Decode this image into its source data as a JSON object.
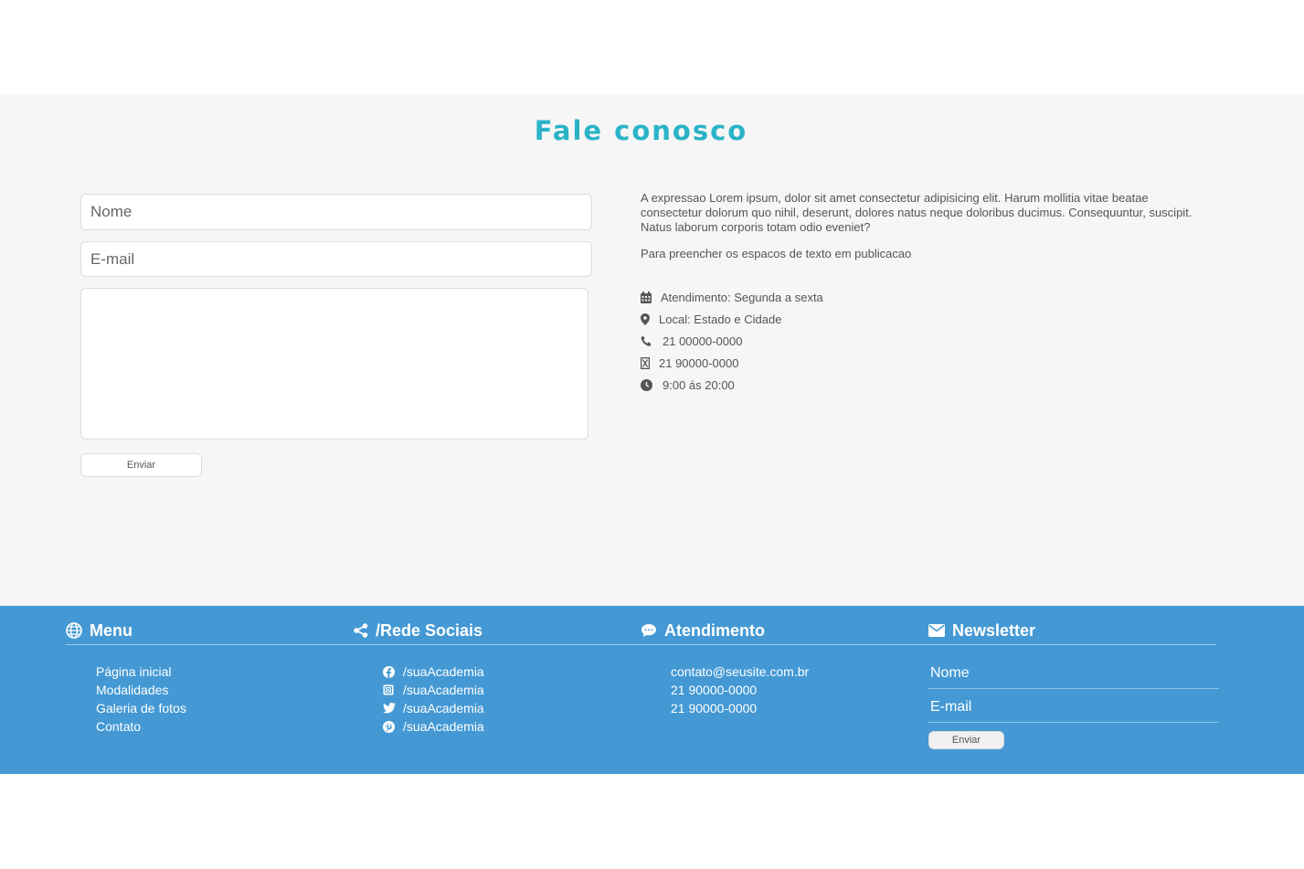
{
  "contact": {
    "title": "Fale conosco",
    "form": {
      "name_placeholder": "Nome",
      "email_placeholder": "E-mail",
      "message_placeholder": "",
      "send_label": "Enviar"
    },
    "description": "A expressao Lorem ipsum, dolor sit amet consectetur adipisicing elit. Harum mollitia vitae beatae consectetur dolorum quo nihil, deserunt, dolores natus neque doloribus ducimus. Consequuntur, suscipit. Natus laborum corporis totam odio eveniet?",
    "subtext": "Para preencher os espacos de texto em publicacao",
    "info": [
      {
        "icon": "calendar-icon",
        "text": "Atendimento: Segunda a sexta"
      },
      {
        "icon": "map-pin-icon",
        "text": "Local: Estado e Cidade"
      },
      {
        "icon": "phone-icon",
        "text": "21 00000-0000"
      },
      {
        "icon": "mobile-icon",
        "text": "21 90000-0000"
      },
      {
        "icon": "clock-icon",
        "text": "9:00 ás 20:00"
      }
    ]
  },
  "footer": {
    "menu": {
      "heading": "Menu",
      "icon": "globe-icon",
      "items": [
        "Página inicial",
        "Modalidades",
        "Galeria de fotos",
        "Contato"
      ]
    },
    "social": {
      "heading": "/Rede Sociais",
      "icon": "share-icon",
      "items": [
        {
          "icon": "facebook-icon",
          "text": "/suaAcademia"
        },
        {
          "icon": "instagram-icon",
          "text": "/suaAcademia"
        },
        {
          "icon": "twitter-icon",
          "text": "/suaAcademia"
        },
        {
          "icon": "pinterest-icon",
          "text": "/suaAcademia"
        }
      ]
    },
    "atendimento": {
      "heading": "Atendimento",
      "icon": "chat-icon",
      "items": [
        "contato@seusite.com.br",
        "21 90000-0000",
        "21 90000-0000"
      ]
    },
    "newsletter": {
      "heading": "Newsletter",
      "icon": "envelope-icon",
      "name_placeholder": "Nome",
      "email_placeholder": "E-mail",
      "send_label": "Enviar"
    }
  },
  "colors": {
    "title": "#2ab3c8",
    "footer_bg": "#4499d4",
    "section_bg": "#f6f6f6"
  }
}
